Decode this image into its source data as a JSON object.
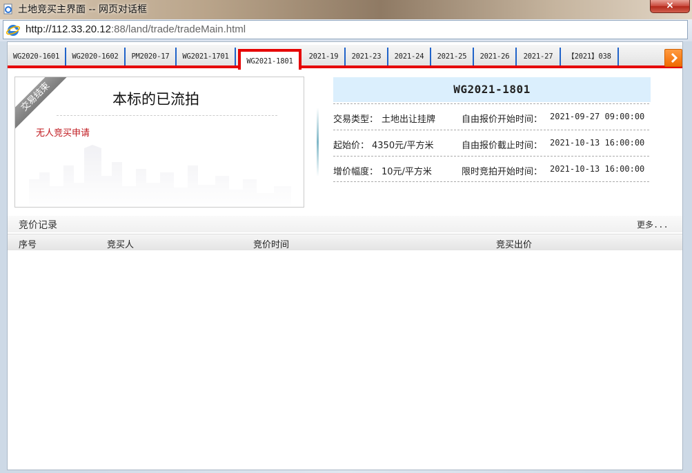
{
  "window": {
    "title": "土地竞买主界面 -- 网页对话框",
    "close_label": "×",
    "colors": {
      "close": "#c8473a",
      "title_bg": "#b9a48a"
    }
  },
  "address": {
    "url_host": "http://112.33.20.12",
    "url_rest": ":88/land/trade/tradeMain.html"
  },
  "tabs": [
    {
      "label": "WG2020-1601"
    },
    {
      "label": "WG2020-1602"
    },
    {
      "label": "PM2020-17"
    },
    {
      "label": "WG2021-1701"
    },
    {
      "label": "WG2021-1801",
      "active": true
    },
    {
      "label": "2021-19"
    },
    {
      "label": "2021-23"
    },
    {
      "label": "2021-24"
    },
    {
      "label": "2021-25"
    },
    {
      "label": "2021-26"
    },
    {
      "label": "2021-27"
    },
    {
      "label": "【2021】038"
    }
  ],
  "status_card": {
    "ribbon": "交易结束",
    "title": "本标的已流拍",
    "reason": "无人竞买申请"
  },
  "info": {
    "header": "WG2021-1801",
    "rows": [
      {
        "left_label": "交易类型：",
        "left_value": "土地出让挂牌",
        "right_label": "自由报价开始时间：",
        "right_value": "2021-09-27 09:00:00"
      },
      {
        "left_label": "起始价：",
        "left_value": "4350元/平方米",
        "right_label": "自由报价截止时间：",
        "right_value": "2021-10-13 16:00:00"
      },
      {
        "left_label": "增价幅度：",
        "left_value": "10元/平方米",
        "right_label": "限时竞拍开始时间：",
        "right_value": "2021-10-13 16:00:00"
      }
    ]
  },
  "bid_records": {
    "title": "竞价记录",
    "more": "更多...",
    "columns": [
      "序号",
      "竞买人",
      "竞价时间",
      "竞买出价"
    ],
    "rows": []
  },
  "accent_colors": {
    "tab_highlight": "#e60000",
    "tab_separator": "#1f62c9",
    "info_header_bg": "#dbeffd",
    "reason_text": "#c0181e",
    "next_button": "#f06a00"
  }
}
